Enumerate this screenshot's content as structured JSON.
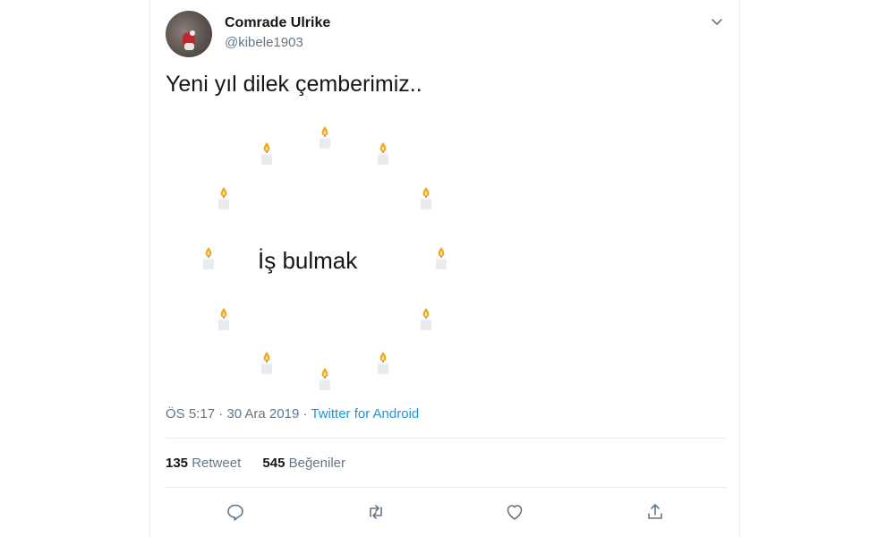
{
  "user": {
    "display_name": "Comrade Ulrike",
    "handle": "@kibele1903"
  },
  "tweet": {
    "text": "Yeni yıl dilek çemberimiz..",
    "center_text": "İş bulmak",
    "candle_count": 12
  },
  "meta": {
    "time": "ÖS 5:17",
    "separator": " · ",
    "date": "30 Ara 2019",
    "source": "Twitter for Android"
  },
  "stats": {
    "retweets_count": "135",
    "retweets_label": "Retweet",
    "likes_count": "545",
    "likes_label": "Beğeniler"
  },
  "actions": [
    "reply-icon",
    "retweet-icon",
    "like-icon",
    "share-icon"
  ],
  "colors": {
    "link": "#1b95e0",
    "secondary_text": "#657786",
    "border": "#e6ecf0",
    "flame": "#f4a51c"
  }
}
